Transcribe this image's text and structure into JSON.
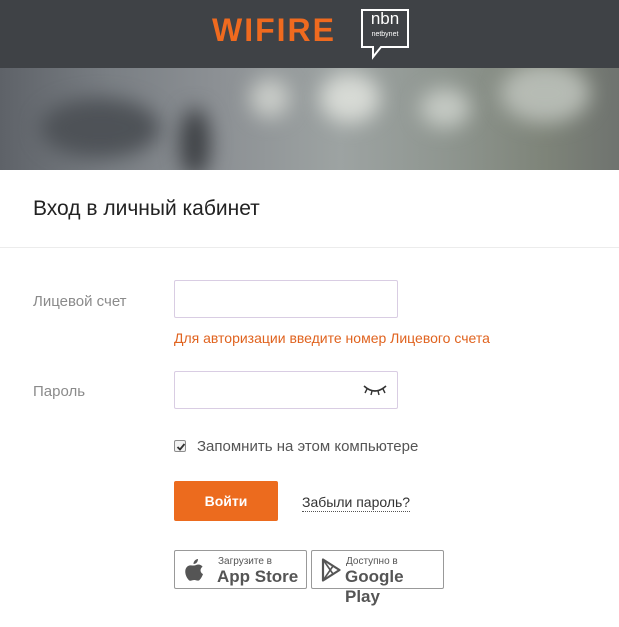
{
  "header": {
    "logo": "WIFIRE",
    "partner_logo": "nbn",
    "partner_sub": "netbynet"
  },
  "form": {
    "title": "Вход в личный кабинет",
    "account_label": "Лицевой счет",
    "account_value": "",
    "account_error": "Для авторизации введите номер Лицевого счета",
    "password_label": "Пароль",
    "password_value": "",
    "remember_label": "Запомнить на этом компьютере",
    "remember_checked": true,
    "login_button": "Войти",
    "forgot_link": "Забыли пароль?"
  },
  "stores": {
    "appstore_small": "Загрузите в",
    "appstore_big": "App Store",
    "googleplay_small": "Доступно в",
    "googleplay_big": "Google Play"
  },
  "colors": {
    "accent": "#ec6b1e",
    "header_bg": "#3f4246",
    "error": "#e0631f"
  }
}
